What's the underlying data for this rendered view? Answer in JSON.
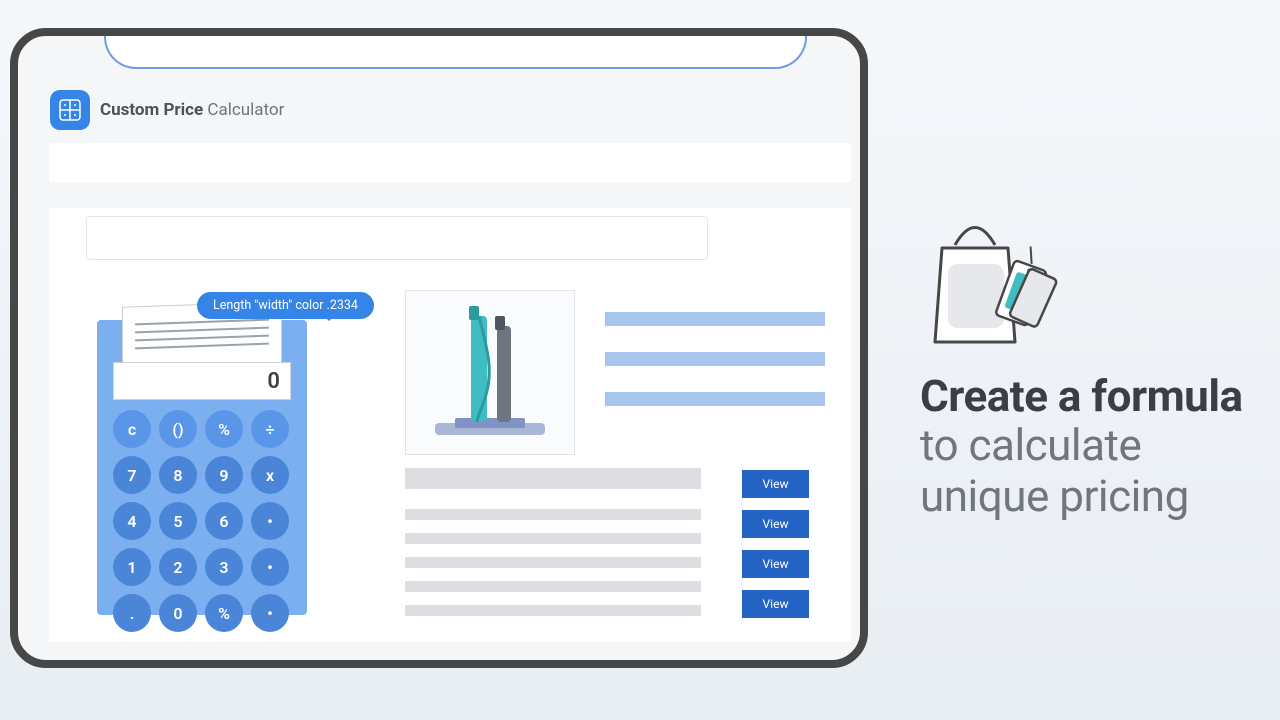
{
  "header": {
    "title_bold": "Custom Price",
    "title_light": " Calculator"
  },
  "calculator": {
    "tooltip": "Length \"width\" color .2334",
    "display": "0",
    "keys": [
      {
        "label": "c",
        "style": "k1"
      },
      {
        "label": "()",
        "style": "k1"
      },
      {
        "label": "%",
        "style": "k1"
      },
      {
        "label": "÷",
        "style": "k1"
      },
      {
        "label": "7",
        "style": "k2"
      },
      {
        "label": "8",
        "style": "k2"
      },
      {
        "label": "9",
        "style": "k2"
      },
      {
        "label": "x",
        "style": "k2"
      },
      {
        "label": "4",
        "style": "k2"
      },
      {
        "label": "5",
        "style": "k2"
      },
      {
        "label": "6",
        "style": "k2"
      },
      {
        "label": "•",
        "style": "k2"
      },
      {
        "label": "1",
        "style": "k2"
      },
      {
        "label": "2",
        "style": "k2"
      },
      {
        "label": "3",
        "style": "k2"
      },
      {
        "label": "•",
        "style": "k2"
      },
      {
        "label": ".",
        "style": "k2"
      },
      {
        "label": "0",
        "style": "k2"
      },
      {
        "label": "%",
        "style": "k2"
      },
      {
        "label": "•",
        "style": "k2"
      }
    ]
  },
  "list": {
    "button_label": "View",
    "count": 4
  },
  "promo": {
    "headline": "Create a formula",
    "subline1": "to calculate",
    "subline2": "unique pricing"
  }
}
